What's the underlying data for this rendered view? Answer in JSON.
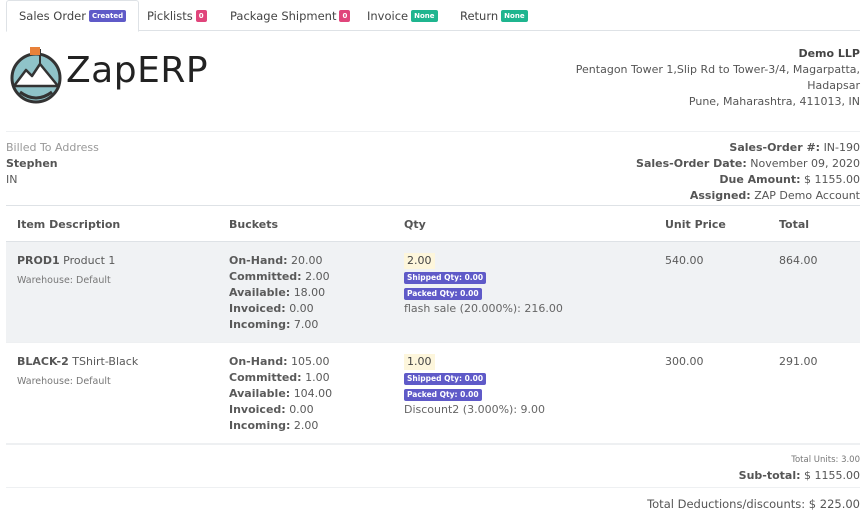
{
  "tabs": [
    {
      "label": "Sales Order",
      "badge": "Created"
    },
    {
      "label": "Picklists",
      "badge": "0"
    },
    {
      "label": "Package Shipment",
      "badge": "0"
    },
    {
      "label": "Invoice",
      "badge": "None"
    },
    {
      "label": "Return",
      "badge": "None"
    }
  ],
  "logo": {
    "text": "ZapERP",
    "icon": "mountain-circle-logo"
  },
  "company": {
    "name": "Demo LLP",
    "address1": "Pentagon Tower 1,Slip Rd to Tower-3/4, Magarpatta,",
    "address2": "Hadapsar",
    "address3": "Pune, Maharashtra, 411013, IN"
  },
  "billed": {
    "label": "Billed To Address",
    "name": "Stephen",
    "country": "IN"
  },
  "meta": {
    "order_label": "Sales-Order #:",
    "order_value": "IN-190",
    "date_label": "Sales-Order Date:",
    "date_value": "November 09, 2020",
    "due_label": "Due Amount:",
    "due_value": "$ 1155.00",
    "assigned_label": "Assigned:",
    "assigned_value": "ZAP Demo Account"
  },
  "table": {
    "headers": {
      "item": "Item Description",
      "buckets": "Buckets",
      "qty": "Qty",
      "unit_price": "Unit Price",
      "total": "Total"
    },
    "bucket_labels": {
      "onhand": "On-Hand:",
      "committed": "Committed:",
      "available": "Available:",
      "invoiced": "Invoiced:",
      "incoming": "Incoming:"
    },
    "rows": [
      {
        "sku": "PROD1",
        "name": "Product 1",
        "warehouse": "Warehouse: Default",
        "onhand": "20.00",
        "committed": "2.00",
        "available": "18.00",
        "invoiced": "0.00",
        "incoming": "7.00",
        "qty": "2.00",
        "shipped": "Shipped Qty: 0.00",
        "packed": "Packed Qty: 0.00",
        "discount": "flash sale (20.000%): 216.00",
        "unit_price": "540.00",
        "total": "864.00"
      },
      {
        "sku": "BLACK-2",
        "name": "TShirt-Black",
        "warehouse": "Warehouse: Default",
        "onhand": "105.00",
        "committed": "1.00",
        "available": "104.00",
        "invoiced": "0.00",
        "incoming": "2.00",
        "qty": "1.00",
        "shipped": "Shipped Qty: 0.00",
        "packed": "Packed Qty: 0.00",
        "discount": "Discount2 (3.000%): 9.00",
        "unit_price": "300.00",
        "total": "291.00"
      }
    ]
  },
  "totals": {
    "units": "Total Units: 3.00",
    "subtotal_label": "Sub-total:",
    "subtotal_value": "$ 1155.00",
    "deductions": "Total Deductions/discounts: $ 225.00"
  },
  "colors": {
    "accent": "#5f5ac8",
    "pink": "#e0457b",
    "green": "#1fb58f"
  }
}
